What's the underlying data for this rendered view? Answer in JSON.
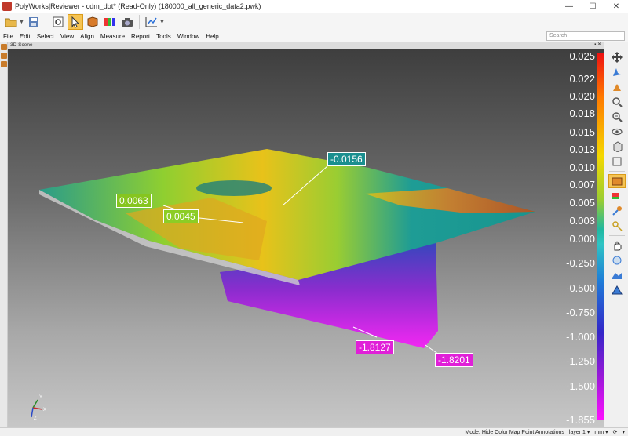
{
  "window": {
    "title": "PolyWorks|Reviewer - cdm_dot* (Read-Only) (180000_all_generic_data2.pwk)",
    "minimize": "—",
    "maximize": "☐",
    "close": "✕"
  },
  "menu": [
    "File",
    "Edit",
    "Select",
    "View",
    "Align",
    "Measure",
    "Report",
    "Tools",
    "Window",
    "Help"
  ],
  "search": {
    "placeholder": "Search"
  },
  "scene": {
    "header": "3D Scene",
    "callouts": [
      {
        "value": "-0.0156",
        "color": "#1a8f8f"
      },
      {
        "value": "0.0063",
        "color": "#86c51f"
      },
      {
        "value": "0.0045",
        "color": "#8ccd25"
      },
      {
        "value": "-1.8127",
        "color": "#e020d8"
      },
      {
        "value": "-1.8201",
        "color": "#e020d8"
      }
    ],
    "axis": {
      "x": "X",
      "y": "Y",
      "z": "Z"
    }
  },
  "color_scale": {
    "labels": [
      "0.025",
      "0.022",
      "0.020",
      "0.018",
      "0.015",
      "0.013",
      "0.010",
      "0.007",
      "0.005",
      "0.003",
      "0.000",
      "-0.250",
      "-0.500",
      "-0.750",
      "-1.000",
      "-1.250",
      "-1.500",
      "-1.855"
    ]
  },
  "status": {
    "mode": "Mode: Hide Color Map Point Annotations",
    "layer": "layer 1",
    "unit": "mm"
  },
  "colors": {
    "accent": "#f6c453",
    "scene_top": "#3e3e3e",
    "scene_bottom": "#c7c7c7"
  }
}
